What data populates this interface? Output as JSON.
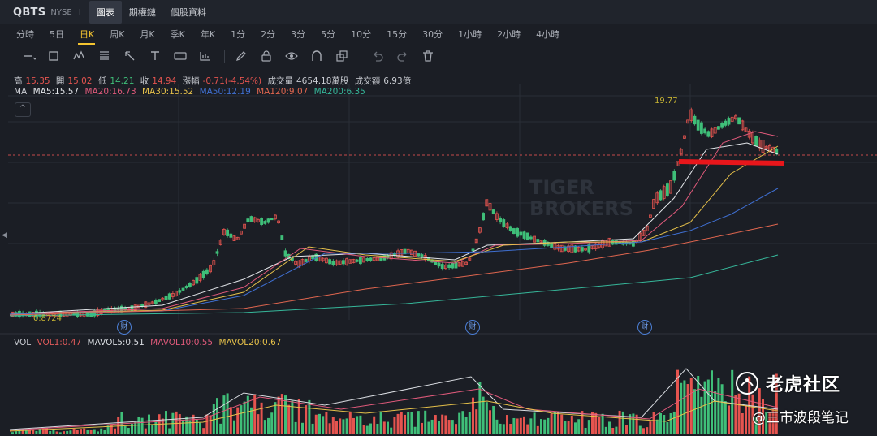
{
  "header": {
    "ticker": "QBTS",
    "exchange": "NYSE",
    "separator": "I",
    "tabs": [
      {
        "label": "圖表",
        "active": true
      },
      {
        "label": "期權鏈",
        "active": false
      },
      {
        "label": "個股資料",
        "active": false
      }
    ]
  },
  "periods": [
    "分時",
    "5日",
    "日K",
    "周K",
    "月K",
    "季K",
    "年K",
    "1分",
    "2分",
    "3分",
    "5分",
    "10分",
    "15分",
    "30分",
    "1小時",
    "2小時",
    "4小時"
  ],
  "active_period": "日K",
  "tools": [
    "line-tool-icon",
    "rectangle-tool-icon",
    "pattern-tool-icon",
    "fibonacci-tool-icon",
    "arrow-tool-icon",
    "text-tool-icon",
    "label-tool-icon",
    "measure-tool-icon",
    "pencil-icon",
    "lock-icon",
    "eye-icon",
    "magnet-icon",
    "layers-icon",
    "undo-icon",
    "redo-icon",
    "trash-icon"
  ],
  "ohlc": {
    "high_label": "高",
    "high": "15.35",
    "open_label": "開",
    "open": "15.02",
    "low_label": "低",
    "low": "14.21",
    "close_label": "收",
    "close": "14.94",
    "change_label": "漲幅",
    "change": "-0.71(-4.54%)",
    "volume_label": "成交量",
    "volume": "4654.18萬股",
    "turnover_label": "成交額",
    "turnover": "6.93億"
  },
  "ma_legend": {
    "label": "MA",
    "items": [
      {
        "text": "MA5:15.57",
        "color": "#e3e6ea"
      },
      {
        "text": "MA20:16.73",
        "color": "#e05a7b"
      },
      {
        "text": "MA30:15.52",
        "color": "#e6c14a"
      },
      {
        "text": "MA50:12.19",
        "color": "#3f6fd1"
      },
      {
        "text": "MA120:9.07",
        "color": "#e0664f"
      },
      {
        "text": "MA200:6.35",
        "color": "#36b79a"
      }
    ]
  },
  "vol_legend": {
    "label": "VOL",
    "items": [
      {
        "text": "VOL1:0.47",
        "color": "#e05a5a"
      },
      {
        "text": "MAVOL5:0.51",
        "color": "#d9dce1"
      },
      {
        "text": "MAVOL10:0.55",
        "color": "#e05a7b"
      },
      {
        "text": "MAVOL20:0.67",
        "color": "#e6c14a"
      }
    ]
  },
  "annotations": {
    "low_price": "0.8724",
    "high_price": "19.77",
    "earnings_marker": "财",
    "collapse_toggle": "^",
    "scroll_left": "◀"
  },
  "watermark": {
    "line1": "TIGER",
    "line2": "BROKERS"
  },
  "overlay": {
    "brand": "老虎社区",
    "caption": "@三市波段笔记"
  },
  "colors": {
    "up": "#e5544f",
    "down": "#3fbf79",
    "accent": "#f4c430",
    "background": "#1b1e25",
    "highlight_line": "#e8161b"
  }
}
